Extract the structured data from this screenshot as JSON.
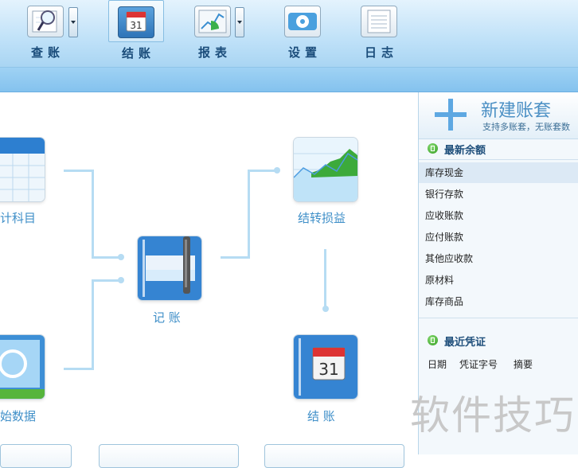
{
  "toolbar": {
    "items": [
      {
        "label": "查账",
        "icon": "magnifier-ledger-icon"
      },
      {
        "label": "结账",
        "icon": "calendar-icon"
      },
      {
        "label": "报表",
        "icon": "chart-icon"
      },
      {
        "label": "设置",
        "icon": "gear-icon"
      },
      {
        "label": "日志",
        "icon": "notepad-icon"
      }
    ],
    "calendar_day": "31"
  },
  "flow": {
    "subject": "计科目",
    "bookkeeping": "记  账",
    "transfer": "结转损益",
    "opening": "始数据",
    "closing": "结  账",
    "closing_day": "31"
  },
  "side": {
    "new_set_title": "新建账套",
    "new_set_desc": "支持多账套，无账套数",
    "balance_title": "最新余额",
    "accounts": [
      "库存现金",
      "银行存款",
      "应收账款",
      "应付账款",
      "其他应收款",
      "原材料",
      "库存商品"
    ],
    "voucher_title": "最近凭证",
    "voucher_headers": [
      "日期",
      "凭证字号",
      "摘要"
    ]
  },
  "watermark": "软件技巧",
  "colors": {
    "accent": "#3f8fc8",
    "connector": "#b6dcf3",
    "toolbar_text": "#1a4c7a"
  }
}
